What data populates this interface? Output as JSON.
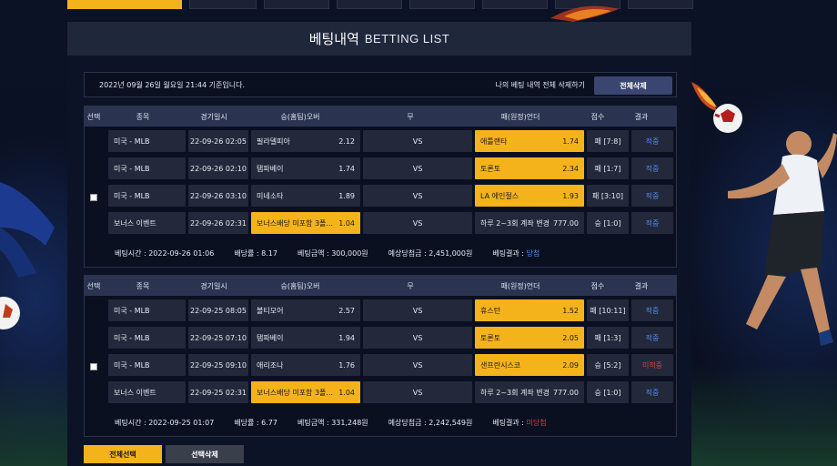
{
  "header": {
    "title_ko": "베팅내역",
    "title_en": "BETTING LIST"
  },
  "info": {
    "timestamp_text": "2022년 09월 26일 월요일 21:44 기준입니다.",
    "delete_all_label": "나의 베팅 내역 전체 삭제하기",
    "delete_all_button": "전체삭제"
  },
  "columns": [
    "선택",
    "종목",
    "경기일시",
    "승(홈팀)오버",
    "무",
    "패(원정)언더",
    "점수",
    "결과"
  ],
  "groups": [
    {
      "rows": [
        {
          "sport": "미국 - MLB",
          "date": "22-09-26 02:05",
          "home": "필라델피아",
          "home_odds": "2.12",
          "draw": "VS",
          "away": "애틀랜타",
          "away_odds": "1.74",
          "score": "패 [7:8]",
          "result": "적중"
        },
        {
          "sport": "미국 - MLB",
          "date": "22-09-26 02:10",
          "home": "탬파베이",
          "home_odds": "1.74",
          "draw": "VS",
          "away": "토론토",
          "away_odds": "2.34",
          "score": "패 [1:7]",
          "result": "적중"
        },
        {
          "sport": "미국 - MLB",
          "date": "22-09-26 03:10",
          "home": "미네소타",
          "home_odds": "1.89",
          "draw": "VS",
          "away": "LA 에인절스",
          "away_odds": "1.93",
          "score": "패 [3:10]",
          "result": "적중"
        },
        {
          "sport": "보너스 이벤트",
          "date": "22-09-26 02:31",
          "home": "보너스배당 미포함 3폴...",
          "home_odds": "1.04",
          "draw": "VS",
          "away": "하루 2~3회 계좌 변경",
          "away_odds": "777.00",
          "score": "승 [1:0]",
          "result": "적중"
        }
      ],
      "summary": {
        "bet_time": "베팅시간 : 2022-09-26 01:06",
        "odds": "배당률 : 8.17",
        "amount": "베팅금액 : 300,000원",
        "expected": "예상당첨금 : 2,451,000원",
        "result_label": "베팅결과 : ",
        "result_value": "당첨"
      }
    },
    {
      "rows": [
        {
          "sport": "미국 - MLB",
          "date": "22-09-25 08:05",
          "home": "볼티모어",
          "home_odds": "2.57",
          "draw": "VS",
          "away": "휴스턴",
          "away_odds": "1.52",
          "score": "패 [10:11]",
          "result": "적중"
        },
        {
          "sport": "미국 - MLB",
          "date": "22-09-25 07:10",
          "home": "탬파베이",
          "home_odds": "1.94",
          "draw": "VS",
          "away": "토론토",
          "away_odds": "2.05",
          "score": "패 [1:3]",
          "result": "적중"
        },
        {
          "sport": "미국 - MLB",
          "date": "22-09-25 09:10",
          "home": "애리조나",
          "home_odds": "1.76",
          "draw": "VS",
          "away": "샌프란시스코",
          "away_odds": "2.09",
          "score": "승 [5:2]",
          "result": "미적중"
        },
        {
          "sport": "보너스 이벤트",
          "date": "22-09-25 02:31",
          "home": "보너스배당 미포함 3폴...",
          "home_odds": "1.04",
          "draw": "VS",
          "away": "하루 2~3회 계좌 변경",
          "away_odds": "777.00",
          "score": "승 [1:0]",
          "result": "적중"
        }
      ],
      "summary": {
        "bet_time": "베팅시간 : 2022-09-25 01:07",
        "odds": "배당률 : 6.77",
        "amount": "베팅금액 : 331,248원",
        "expected": "예상당첨금 : 2,242,549원",
        "result_label": "베팅결과 : ",
        "result_value": "미당첨"
      }
    }
  ],
  "footer": {
    "select_all": "전체선택",
    "delete_selected": "선택삭제"
  },
  "colors": {
    "accent": "#f4b31a",
    "win": "#4f8df0",
    "lose": "#e23a3a"
  }
}
